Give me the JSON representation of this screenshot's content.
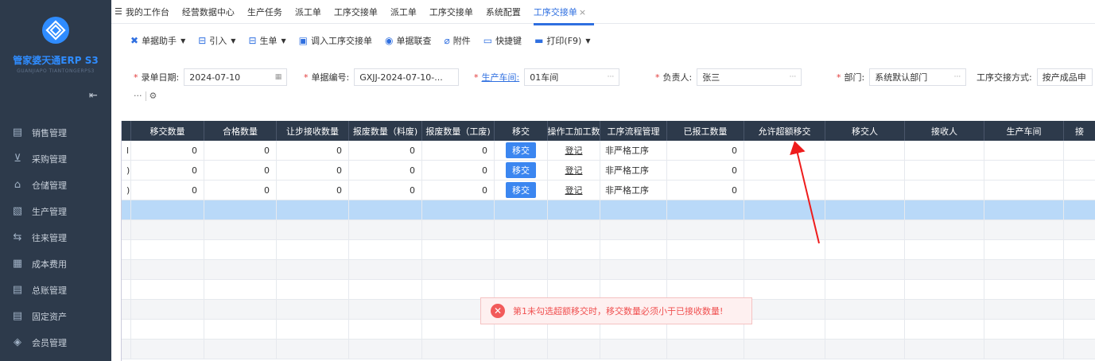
{
  "sidebar": {
    "brand": "管家婆天通ERP S3",
    "brand_sub": "GUANJIAPO TIANTONGERPS3",
    "items": [
      {
        "icon": "doc-icon",
        "label": "销售管理"
      },
      {
        "icon": "cart-icon",
        "label": "采购管理"
      },
      {
        "icon": "warehouse-icon",
        "label": "仓储管理"
      },
      {
        "icon": "factory-icon",
        "label": "生产管理"
      },
      {
        "icon": "exchange-icon",
        "label": "往来管理"
      },
      {
        "icon": "calculator-icon",
        "label": "成本费用"
      },
      {
        "icon": "ledger-icon",
        "label": "总账管理"
      },
      {
        "icon": "asset-icon",
        "label": "固定资产"
      },
      {
        "icon": "diamond-icon",
        "label": "会员管理"
      }
    ]
  },
  "tabs": [
    "我的工作台",
    "经营数据中心",
    "生产任务",
    "派工单",
    "工序交接单",
    "派工单",
    "工序交接单",
    "系统配置",
    "工序交接单"
  ],
  "active_tab_close": "×",
  "toolbar": {
    "assistant": "单据助手",
    "import": "引入",
    "generate": "生单",
    "load": "调入工序交接单",
    "query": "单据联查",
    "attach": "附件",
    "hotkey": "快捷键",
    "print": "打印(F9)"
  },
  "form": {
    "date_label": "录单日期:",
    "date_value": "2024-07-10",
    "no_label": "单据编号:",
    "no_value": "GXJJ-2024-07-10-...",
    "workshop_label": "生产车间:",
    "workshop_value": "01车间",
    "owner_label": "负责人:",
    "owner_value": "张三",
    "dept_label": "部门:",
    "dept_value": "系统默认部门",
    "method_label": "工序交接方式:",
    "method_value": "按产成品申",
    "ellipsis": "···"
  },
  "grid": {
    "headers": [
      "移交数量",
      "合格数量",
      "让步接收数量",
      "报废数量（料废)",
      "报废数量（工废)",
      "移交",
      "操作工加工数",
      "工序流程管理",
      "已报工数量",
      "允许超额移交",
      "移交人",
      "接收人",
      "生产车间",
      "接"
    ],
    "rows": [
      {
        "lead": "l",
        "move_qty": "0",
        "ok_qty": "0",
        "accept_qty": "0",
        "scrap_mat": "0",
        "scrap_work": "0",
        "btn": "移交",
        "op": "登记",
        "flow": "非严格工序",
        "reported": "0"
      },
      {
        "lead": ")",
        "move_qty": "0",
        "ok_qty": "0",
        "accept_qty": "0",
        "scrap_mat": "0",
        "scrap_work": "0",
        "btn": "移交",
        "op": "登记",
        "flow": "非严格工序",
        "reported": "0"
      },
      {
        "lead": ")",
        "move_qty": "0",
        "ok_qty": "0",
        "accept_qty": "0",
        "scrap_mat": "0",
        "scrap_work": "0",
        "btn": "移交",
        "op": "登记",
        "flow": "非严格工序",
        "reported": "0"
      }
    ]
  },
  "toast": {
    "message": "第1未勾选超额移交时，移交数量必须小于已接收数量!"
  }
}
